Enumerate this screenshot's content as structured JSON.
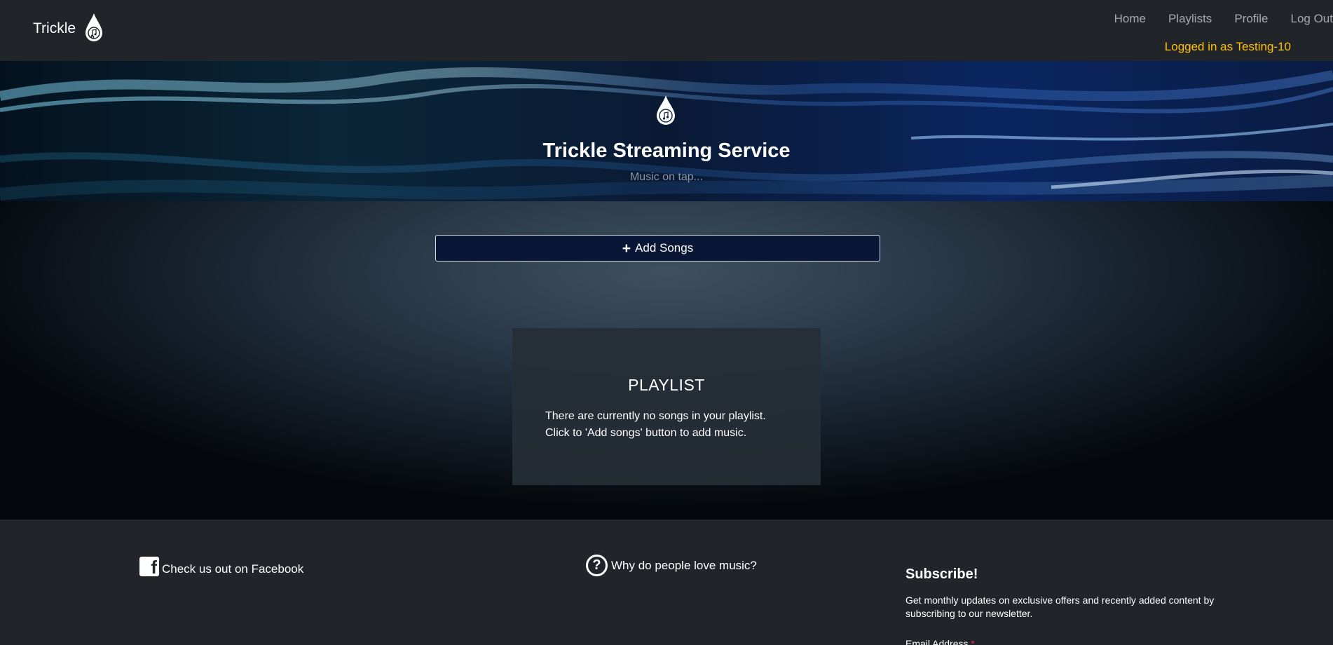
{
  "navbar": {
    "brand": "Trickle",
    "links": [
      "Home",
      "Playlists",
      "Profile",
      "Log Out"
    ],
    "logged_in": "Logged in as Testing-10"
  },
  "hero": {
    "title": "Trickle Streaming Service",
    "subtitle": "Music on tap..."
  },
  "main": {
    "add_button": "Add Songs",
    "playlist": {
      "title": "PLAYLIST",
      "line1": "There are currently no songs in your playlist.",
      "line2": "Click to 'Add songs' button to add music."
    }
  },
  "footer": {
    "facebook": "Check us out on Facebook",
    "why": "Why do people love music?",
    "subscribe_title": "Subscribe!",
    "subscribe_desc": "Get monthly updates on exclusive offers and recently added content by subscribing to our newsletter.",
    "email_label": "Email Address",
    "required_mark": "*"
  },
  "icons": {
    "brand": "music-drop-icon",
    "add": "plus-icon",
    "facebook": "facebook-icon",
    "question": "question-circle-icon"
  },
  "colors": {
    "navbar_bg": "#212529",
    "accent_yellow": "#ffc107",
    "button_bg": "#0a1636",
    "required": "#dc3545"
  }
}
